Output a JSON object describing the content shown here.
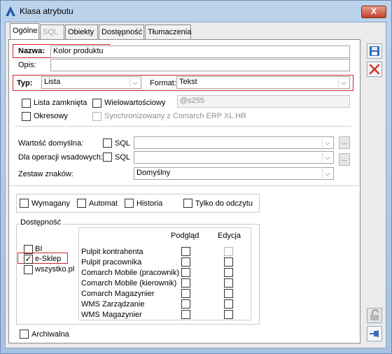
{
  "window": {
    "title": "Klasa atrybutu",
    "close_label": "X"
  },
  "tabs": [
    {
      "label": "Ogólne"
    },
    {
      "label": "SQL"
    },
    {
      "label": "Obiekty"
    },
    {
      "label": "Dostępność"
    },
    {
      "label": "Tłumaczenia"
    }
  ],
  "form": {
    "nazwa_label": "Nazwa:",
    "nazwa_value": "Kolor produktu",
    "opis_label": "Opis:",
    "opis_value": "",
    "typ_label": "Typ:",
    "typ_value": "Lista",
    "format_label": "Format:",
    "format_value": "Tekst",
    "lista_zamknieta": "Lista zamknięta",
    "wielowartosciowy": "Wielowartościowy",
    "placeholder_s255": "@s255",
    "okresowy": "Okresowy",
    "synchronizowany": "Synchronizowany z Comarch ERP XL HR",
    "wartosc_domyslna": "Wartość domyślna:",
    "dla_operacji": "Dla operacji wsadowych:",
    "sql_label": "SQL",
    "zestaw_znakow": "Zestaw znaków:",
    "zestaw_value": "Domyślny",
    "ellipsis": "..."
  },
  "flags": {
    "wymagany": "Wymagany",
    "automat": "Automat",
    "historia": "Historia",
    "tylko_do_odczytu": "Tylko do odczytu"
  },
  "dostepnosc": {
    "title": "Dostępność",
    "modules": [
      {
        "label": "BI",
        "checked": false
      },
      {
        "label": "e-Sklep",
        "checked": true
      },
      {
        "label": "wszystko.pl",
        "checked": false
      }
    ],
    "col_podglad": "Podgląd",
    "col_edycja": "Edycja",
    "rows": [
      {
        "label": "Pulpit kontrahenta"
      },
      {
        "label": "Pulpit pracownika"
      },
      {
        "label": "Comarch Mobile (pracownik)"
      },
      {
        "label": "Comarch Mobile (kierownik)"
      },
      {
        "label": "Comarch Magazynier"
      },
      {
        "label": "WMS Zarządzanie"
      },
      {
        "label": "WMS Magazynier"
      }
    ]
  },
  "archiwalna": "Archiwalna",
  "check_mark": "✓"
}
